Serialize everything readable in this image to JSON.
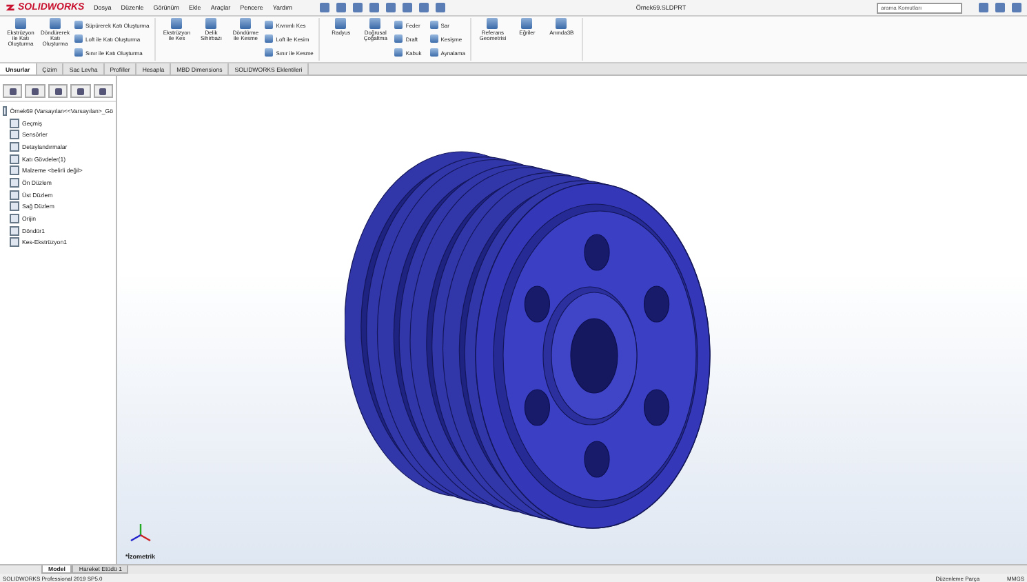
{
  "window": {
    "app_name": "SOLIDWORKS",
    "menus": [
      "Dosya",
      "Düzenle",
      "Görünüm",
      "Ekle",
      "Araçlar",
      "Pencere",
      "Yardım"
    ],
    "title": "Örnek69.SLDPRT",
    "search": {
      "placeholder": "arama Komutları"
    }
  },
  "ribbon": {
    "groups": [
      {
        "large": [
          "Ekstrüzyon ile Katı Oluşturma",
          "Döndürerek Katı Oluşturma"
        ],
        "small": [
          "Süpürerek Katı Oluşturma",
          "Loft ile Katı Oluşturma",
          "Sınır ile Katı Oluşturma"
        ]
      },
      {
        "large": [
          "Ekstrüzyon ile Kes",
          "Delik Sihirbazı",
          "Döndürme ile Kesme"
        ],
        "small": [
          "Kıvrımlı Kes",
          "Loft ile Kesim",
          "Sınır ile Kesme"
        ]
      },
      {
        "large": [
          "Radyus",
          "Doğrusal Çoğaltma"
        ],
        "small": [
          "Feder",
          "Draft",
          "Kabuk",
          "Sar",
          "Kesişme",
          "Aynalama"
        ]
      },
      {
        "large": [
          "Referans Geometrisi",
          "Eğriler",
          "Anında3B"
        ]
      }
    ]
  },
  "tabs": [
    {
      "label": "Unsurlar",
      "selected": true
    },
    {
      "label": "Çizim",
      "selected": false
    },
    {
      "label": "Sac Levha",
      "selected": false
    },
    {
      "label": "Profiller",
      "selected": false
    },
    {
      "label": "Hesapla",
      "selected": false
    },
    {
      "label": "MBD Dimensions",
      "selected": false
    },
    {
      "label": "SOLIDWORKS Eklentileri",
      "selected": false
    }
  ],
  "feature_tree": {
    "root": "Örnek69  (Varsayılan<<Varsayılan>_Gö",
    "items": [
      "Geçmiş",
      "Sensörler",
      "Detaylandırmalar",
      "Katı Gövdeler(1)",
      "Malzeme <belirli değil>",
      "Ön Düzlem",
      "Üst Düzlem",
      "Sağ Düzlem",
      "Orijin",
      "Döndür1",
      "Kes-Ekstrüzyon1"
    ]
  },
  "viewport": {
    "view_label": "*İzometrik"
  },
  "bottom_tabs": [
    {
      "label": "Model",
      "selected": true
    },
    {
      "label": "Hareket Etüdü 1",
      "selected": false
    }
  ],
  "status_bar": {
    "version": "SOLIDWORKS Professional 2019 SP5.0",
    "mode": "Düzenleme Parça",
    "units": "MMGS"
  }
}
